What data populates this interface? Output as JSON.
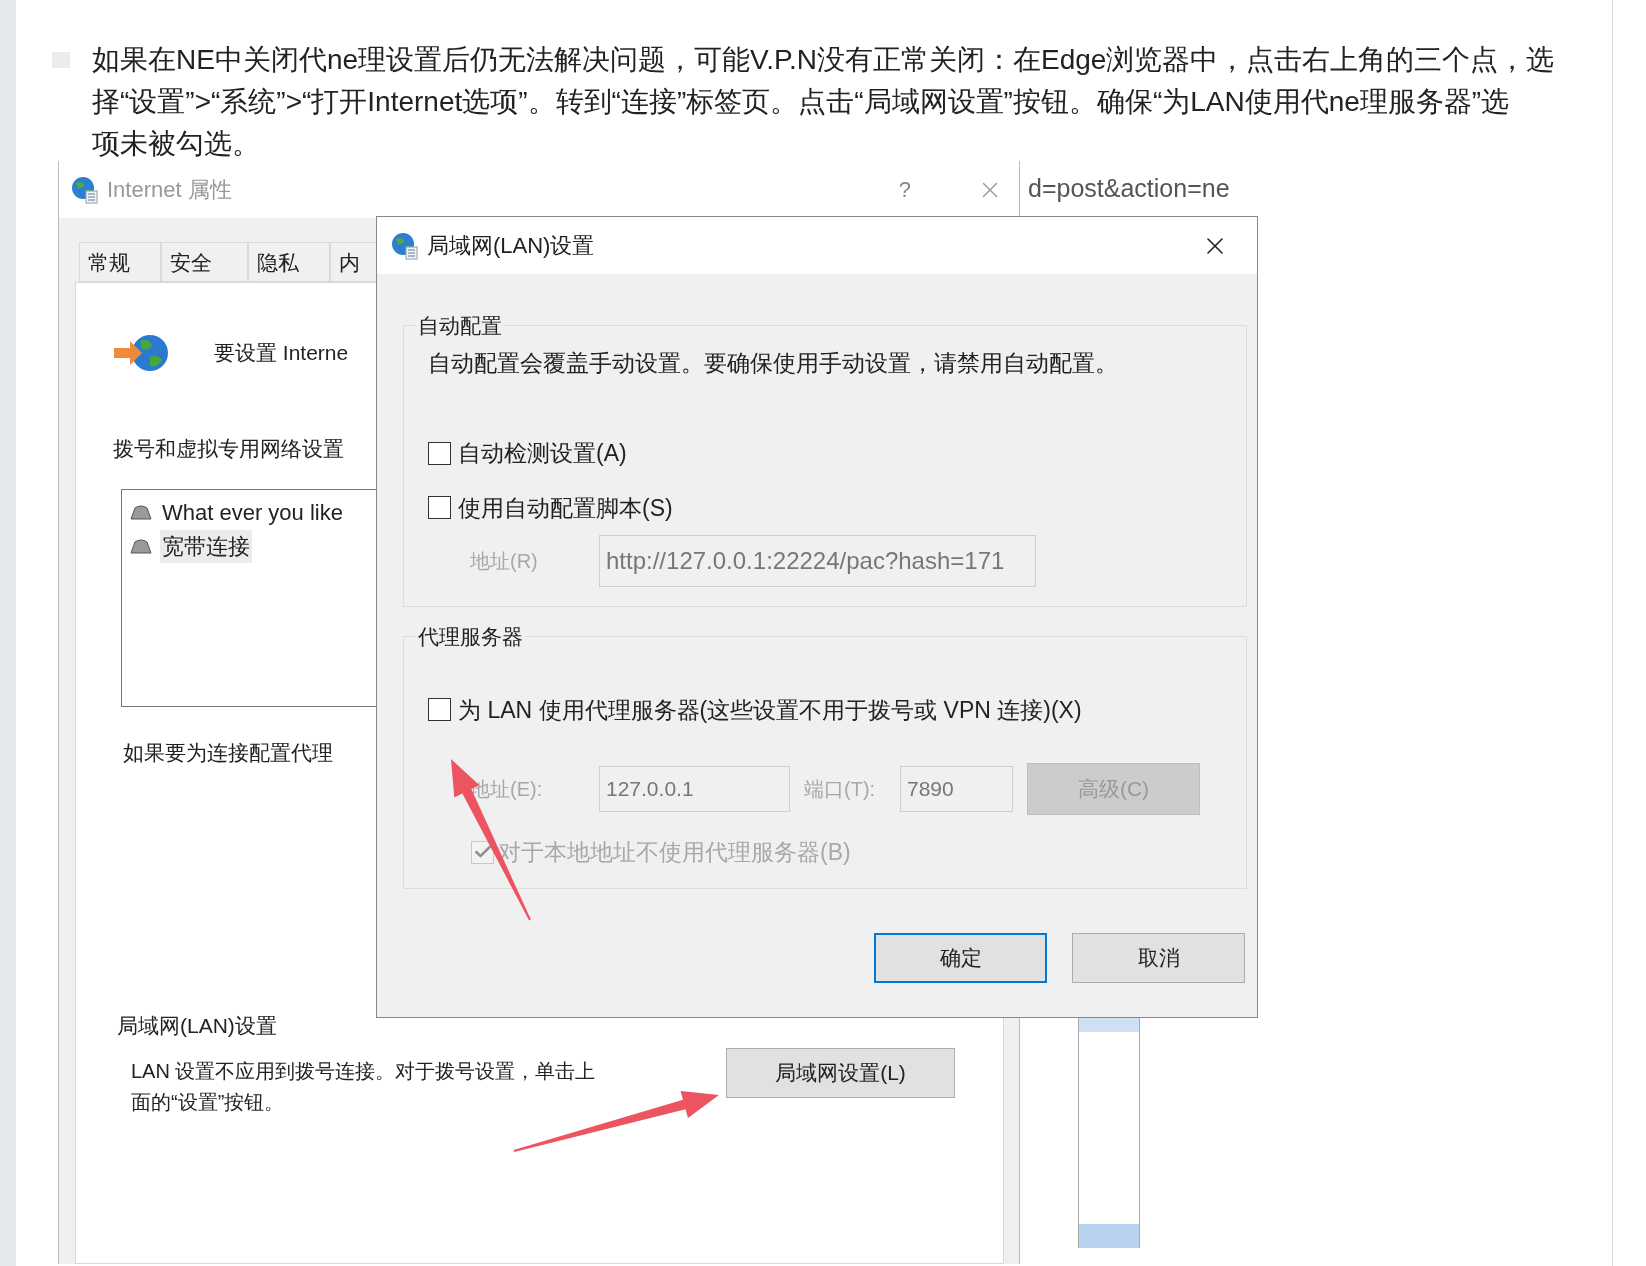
{
  "article": {
    "paragraph_lines": [
      "如果在NE中关闭代ne理设置后仍无法解决问题，可能V.P.N没有正常关闭：在Edge浏览器中，点击右上角的三个点，选",
      "择“设置”>“系统”>“打开Internet选项”。转到“连接”标签页。点击“局域网设置”按钮。确保“为LAN使用代ne理服务器”选",
      "项未被勾选。"
    ]
  },
  "screenshot": {
    "internet_properties": {
      "title": "Internet 属性",
      "help_button": "?",
      "tabs": [
        {
          "label": "常规",
          "selected": false
        },
        {
          "label": "安全",
          "selected": false
        },
        {
          "label": "隐私",
          "selected": false
        },
        {
          "label": "内",
          "selected": false
        }
      ],
      "setup_text": "要设置 Interne",
      "vpn_heading": "拨号和虚拟专用网络设置",
      "connections": [
        {
          "name": "What ever you like",
          "selected": false
        },
        {
          "name": "宽带连接",
          "selected": true
        }
      ],
      "proxy_text": "如果要为连接配置代理",
      "lan_heading": "局域网(LAN)设置",
      "lan_text_lines": [
        "LAN 设置不应用到拨号连接。对于拨号设置，单击上",
        "面的“设置”按钮。"
      ],
      "lan_button": "局域网设置(L)"
    },
    "browser_url": "d=post&action=ne",
    "lan_dialog": {
      "title": "局域网(LAN)设置",
      "auto_config": {
        "legend": "自动配置",
        "note": "自动配置会覆盖手动设置。要确保使用手动设置，请禁用自动配置。",
        "options": [
          {
            "label": "自动检测设置(A)",
            "checked": false
          },
          {
            "label": "使用自动配置脚本(S)",
            "checked": false
          }
        ],
        "address_label": "地址(R)",
        "address_value": "http://127.0.0.1:22224/pac?hash=171",
        "address_disabled": true
      },
      "proxy": {
        "legend": "代理服务器",
        "use_proxy": {
          "label": "为 LAN 使用代理服务器(这些设置不用于拨号或 VPN 连接)(X)",
          "checked": false
        },
        "fields_disabled": true,
        "address_label": "地址(E):",
        "address_value": "127.0.0.1",
        "port_label": "端口(T):",
        "port_value": "7890",
        "advanced_button": "高级(C)",
        "bypass": {
          "label": "对于本地地址不使用代理服务器(B)",
          "checked": true
        }
      },
      "buttons": [
        {
          "label": "确定",
          "default": true
        },
        {
          "label": "取消",
          "default": false
        }
      ]
    }
  }
}
